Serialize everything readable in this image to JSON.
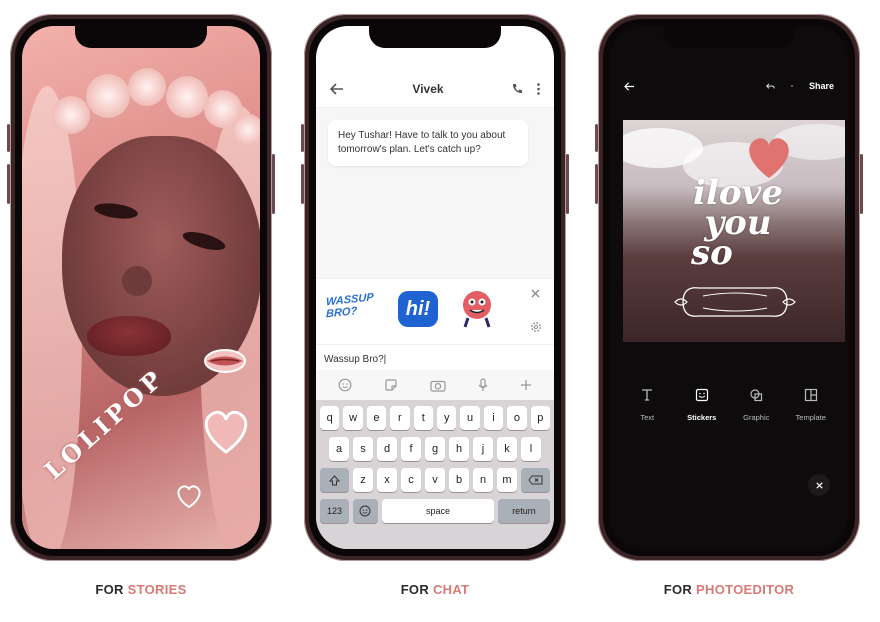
{
  "colors": {
    "accent": "#d77b74",
    "caption_text": "#2b2b2b",
    "frame": "#3a2426"
  },
  "stories": {
    "sticker_text": "LOLIPOP",
    "caption_prefix": "FOR ",
    "caption_accent": "STORIES"
  },
  "chat": {
    "contact_name": "Vivek",
    "message": "Hey Tushar! Have to talk to you about tomorrow's plan. Let's catch up?",
    "stickers": [
      "WASSUP BRO?",
      "hi!"
    ],
    "compose_value": "Wassup Bro?",
    "keyboard": {
      "row1": [
        "q",
        "w",
        "e",
        "r",
        "t",
        "y",
        "u",
        "i",
        "o",
        "p"
      ],
      "row2": [
        "a",
        "s",
        "d",
        "f",
        "g",
        "h",
        "j",
        "k",
        "l"
      ],
      "row3": [
        "z",
        "x",
        "c",
        "v",
        "b",
        "n",
        "m"
      ],
      "numbers_label": "123",
      "space_label": "space",
      "return_label": "return"
    },
    "caption_prefix": "FOR ",
    "caption_accent": "CHAT"
  },
  "editor": {
    "share_label": "Share",
    "overlay_text": [
      "ilove",
      "you",
      "so"
    ],
    "tools": [
      {
        "label": "Text",
        "icon": "text-icon"
      },
      {
        "label": "Stickers",
        "icon": "sticker-icon"
      },
      {
        "label": "Graphic",
        "icon": "graphic-icon"
      },
      {
        "label": "Template",
        "icon": "template-icon"
      }
    ],
    "active_tool": "Stickers",
    "caption_prefix": "FOR ",
    "caption_accent": "PHOTOEDITOR"
  }
}
